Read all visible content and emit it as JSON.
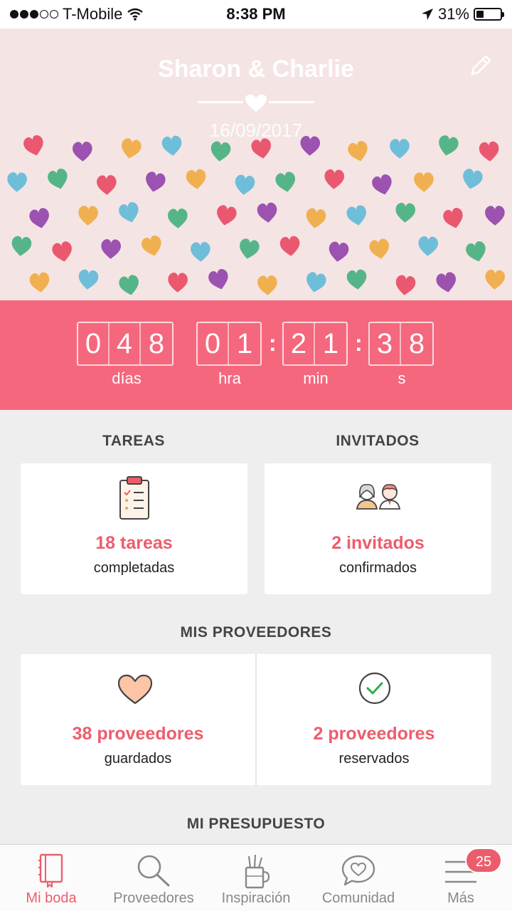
{
  "status_bar": {
    "carrier": "T-Mobile",
    "time": "8:38 PM",
    "battery": "31%",
    "battery_level": 0.31,
    "signal_bars": 3
  },
  "header": {
    "couple_names": "Sharon & Charlie",
    "date": "16/09/2017"
  },
  "countdown": {
    "days": [
      "0",
      "4",
      "8"
    ],
    "hours": [
      "0",
      "1"
    ],
    "minutes": [
      "2",
      "1"
    ],
    "seconds": [
      "3",
      "8"
    ],
    "labels": {
      "days": "días",
      "hours": "hra",
      "minutes": "min",
      "seconds": "s"
    }
  },
  "tasks": {
    "title": "TAREAS",
    "count": "18 tareas",
    "sub": "completadas"
  },
  "guests": {
    "title": "INVITADOS",
    "count": "2 invitados",
    "sub": "confirmados"
  },
  "vendors": {
    "title": "MIS PROVEEDORES",
    "saved_count": "38 proveedores",
    "saved_sub": "guardados",
    "booked_count": "2 proveedores",
    "booked_sub": "reservados"
  },
  "budget": {
    "title": "MI PRESUPUESTO"
  },
  "tab_bar": {
    "items": [
      {
        "label": "Mi boda",
        "icon": "notebook-icon",
        "active": true
      },
      {
        "label": "Proveedores",
        "icon": "search-icon",
        "active": false
      },
      {
        "label": "Inspiración",
        "icon": "pencil-cup-icon",
        "active": false
      },
      {
        "label": "Comunidad",
        "icon": "chat-heart-icon",
        "active": false
      },
      {
        "label": "Más",
        "icon": "menu-icon",
        "active": false
      }
    ],
    "badge": "25"
  },
  "colors": {
    "accent": "#ec5d6c",
    "countdown_bg": "#f5677d",
    "header_bg": "#f5e4e4"
  }
}
